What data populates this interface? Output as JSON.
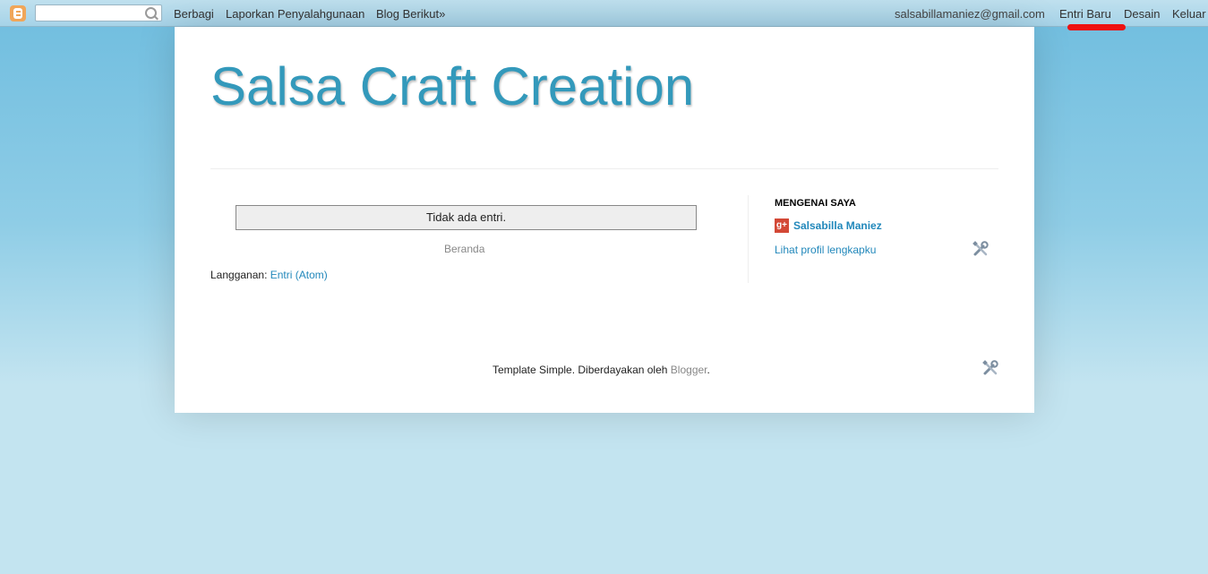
{
  "navbar": {
    "search_placeholder": "",
    "links": {
      "share": "Berbagi",
      "report_abuse": "Laporkan Penyalahgunaan",
      "next_blog": "Blog Berikut»"
    },
    "account_email": "salsabillamaniez@gmail.com",
    "new_post": "Entri Baru",
    "design": "Desain",
    "sign_out": "Keluar"
  },
  "blog": {
    "title": "Salsa Craft Creation"
  },
  "main": {
    "status_message": "Tidak ada entri.",
    "home_link": "Beranda",
    "feed_label": "Langganan:",
    "feed_link": "Entri (Atom)"
  },
  "sidebar": {
    "about_title": "MENGENAI SAYA",
    "profile_name": "Salsabilla Maniez",
    "profile_link": "Lihat profil lengkapku"
  },
  "footer": {
    "text": "Template Simple. Diberdayakan oleh",
    "link": "Blogger",
    "period": "."
  },
  "colors": {
    "title": "#3399bb",
    "link": "#2288bb",
    "highlight_mark": "#ee1111",
    "google_plus": "#d34836",
    "blogger_logo": "#f0a659"
  },
  "icons": {
    "logo": "blogger-logo-icon",
    "search": "search-icon",
    "profile_badge": "google-plus-icon",
    "edit_widget": "tools-icon"
  }
}
